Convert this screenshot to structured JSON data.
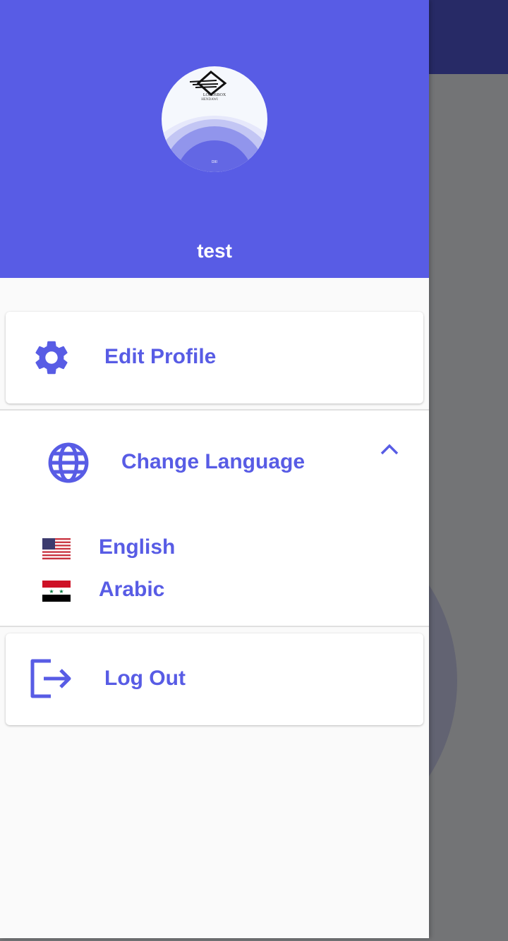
{
  "user": {
    "name": "test",
    "avatar_logo_text": "LORDSBOX HENDAWI"
  },
  "menu": {
    "edit_profile": "Edit Profile",
    "change_language": "Change Language",
    "languages": [
      {
        "label": "English",
        "flag": "us-flag"
      },
      {
        "label": "Arabic",
        "flag": "syria-flag"
      }
    ],
    "log_out": "Log Out"
  },
  "colors": {
    "accent": "#585ce5",
    "header": "#585ce5",
    "scrim": "#737476"
  }
}
